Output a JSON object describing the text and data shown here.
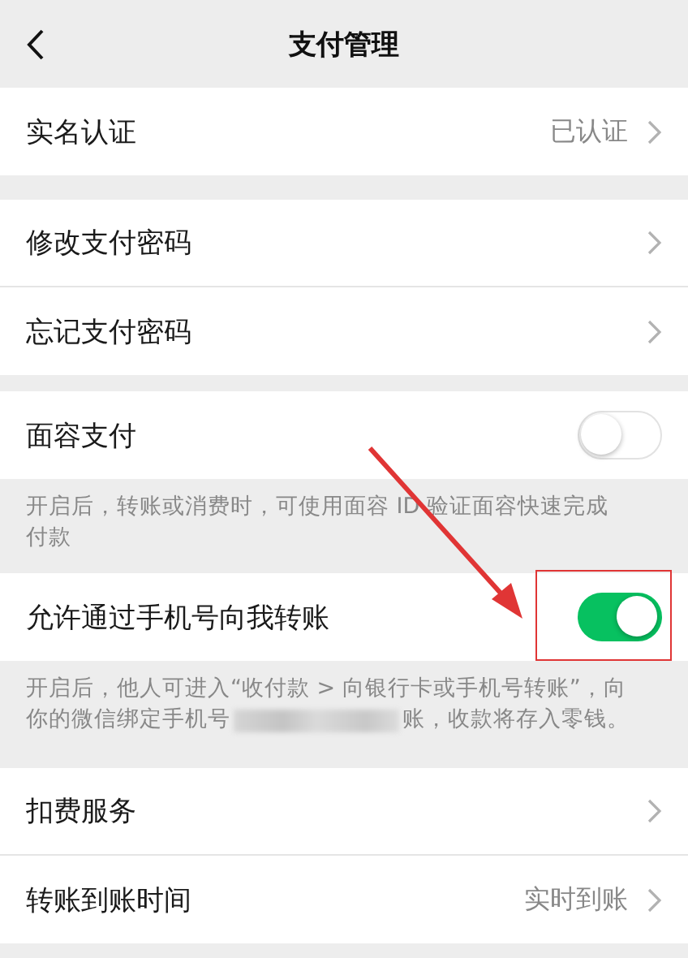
{
  "header": {
    "title": "支付管理"
  },
  "groups": [
    {
      "rows": [
        {
          "kind": "link",
          "label": "实名认证",
          "value": "已认证"
        }
      ]
    },
    {
      "rows": [
        {
          "kind": "link",
          "label": "修改支付密码"
        },
        {
          "kind": "link",
          "label": "忘记支付密码"
        }
      ]
    },
    {
      "rows": [
        {
          "kind": "toggle",
          "label": "面容支付",
          "on": false
        }
      ],
      "note": [
        {
          "kind": "text",
          "text": "开启后，转账或消费时，可使用面容 ID 验证面容快速完成付款"
        }
      ]
    },
    {
      "rows": [
        {
          "kind": "toggle",
          "label": "允许通过手机号向我转账",
          "on": true,
          "highlighted": true
        }
      ],
      "note": [
        {
          "kind": "text",
          "text": "开启后，他人可进入“收付款 > 向银行卡或手机号转账”，向"
        },
        {
          "kind": "break"
        },
        {
          "kind": "text",
          "text": "你的微信绑定手机号"
        },
        {
          "kind": "redacted"
        },
        {
          "kind": "text",
          "text": "账，收款将存入零钱。"
        }
      ]
    },
    {
      "rows": [
        {
          "kind": "link",
          "label": "扣费服务"
        },
        {
          "kind": "link",
          "label": "转账到账时间",
          "value": "实时到账"
        }
      ]
    }
  ]
}
